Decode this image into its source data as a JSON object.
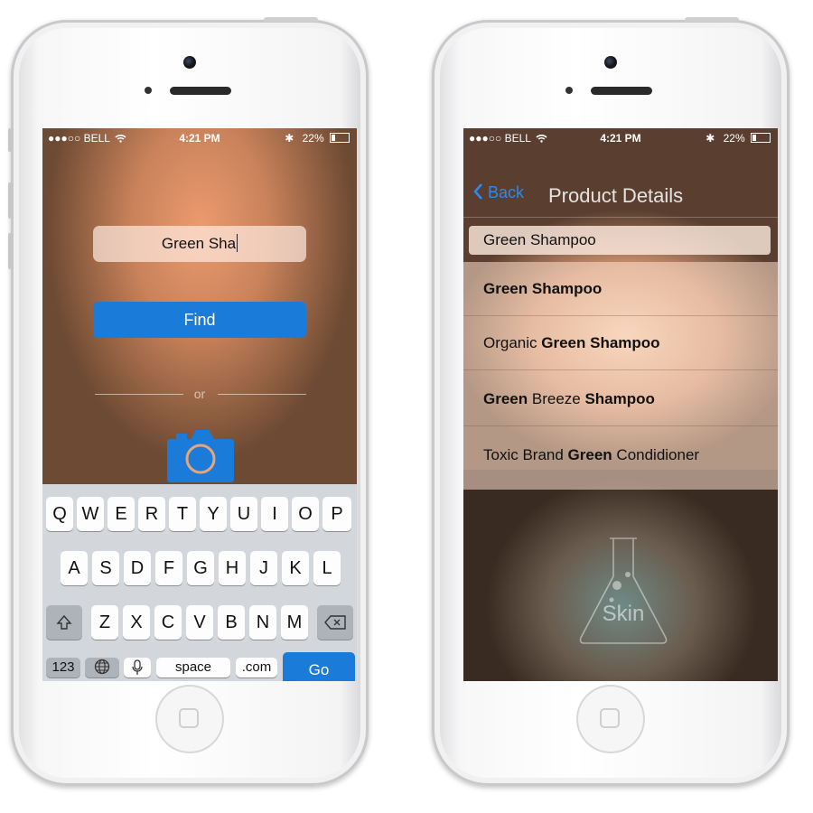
{
  "status": {
    "carrier": "●●●○○ BELL",
    "time": "4:21 PM",
    "battery": "22%"
  },
  "left": {
    "search_value": "Green Sha",
    "find_label": "Find",
    "or_label": "or",
    "keyboard": {
      "row1": [
        "Q",
        "W",
        "E",
        "R",
        "T",
        "Y",
        "U",
        "I",
        "O",
        "P"
      ],
      "row2": [
        "A",
        "S",
        "D",
        "F",
        "G",
        "H",
        "J",
        "K",
        "L"
      ],
      "row3": [
        "Z",
        "X",
        "C",
        "V",
        "B",
        "N",
        "M"
      ],
      "numbers": "123",
      "space": "space",
      "dotcom": ".com",
      "go": "Go"
    }
  },
  "right": {
    "back_label": "Back",
    "title": "Product Details",
    "field_value": "Green Shampoo",
    "results": [
      {
        "prefix": "",
        "bold1": "Green Shampoo",
        "middle": "",
        "bold2": "",
        "suffix": ""
      },
      {
        "prefix": "Organic ",
        "bold1": "Green Shampoo",
        "middle": "",
        "bold2": "",
        "suffix": ""
      },
      {
        "prefix": "",
        "bold1": "Green",
        "middle": " Breeze ",
        "bold2": "Shampoo",
        "suffix": ""
      },
      {
        "prefix": "Toxic Brand ",
        "bold1": "Green",
        "middle": " Condidioner",
        "bold2": "",
        "suffix": ""
      }
    ],
    "logo_text": "Skin"
  },
  "colors": {
    "accent": "#1a7bd8",
    "back_blue": "#2a8af0"
  }
}
